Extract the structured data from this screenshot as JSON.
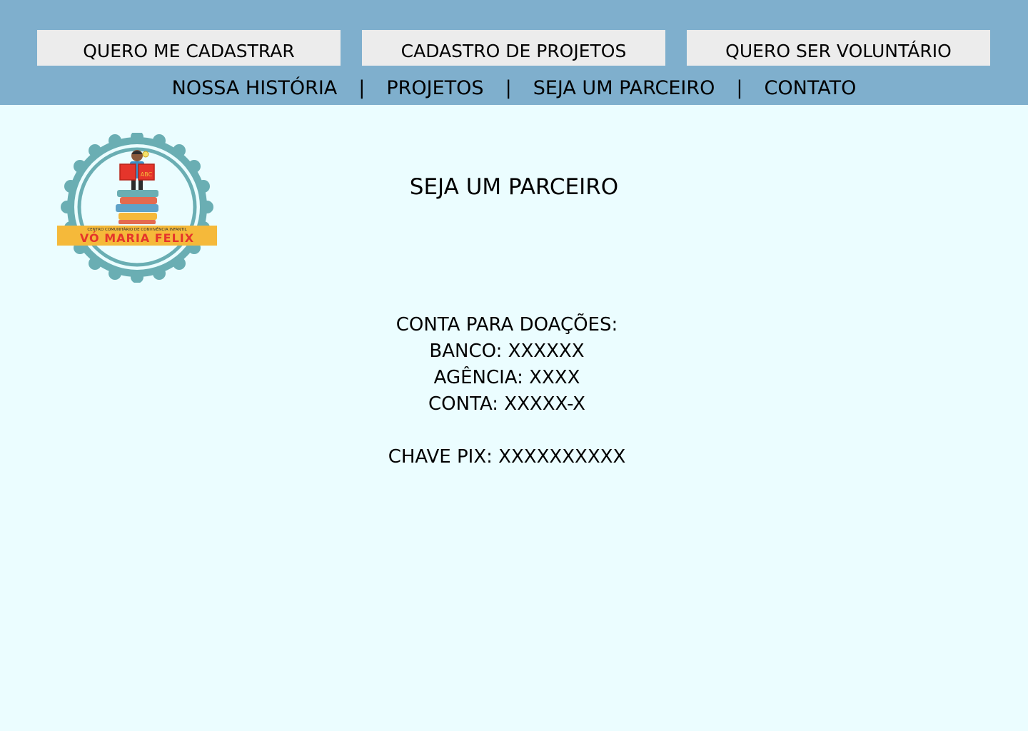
{
  "header": {
    "buttons": [
      {
        "label": "QUERO ME CADASTRAR"
      },
      {
        "label": "CADASTRO DE PROJETOS"
      },
      {
        "label": "QUERO SER VOLUNTÁRIO"
      }
    ],
    "nav": {
      "items": [
        "NOSSA HISTÓRIA",
        "PROJETOS",
        "SEJA UM PARCEIRO",
        "CONTATO"
      ],
      "separator": "|"
    }
  },
  "logo": {
    "subtitle": "CENTRO COMUNITÁRIO DE CONVIVÊNCIA INFANTIL",
    "name": "VÓ MARIA FELIX",
    "book_text": "ABC"
  },
  "main": {
    "title": "SEJA UM PARCEIRO",
    "donation": {
      "heading": "CONTA PARA DOAÇÕES:",
      "bank": "BANCO: XXXXXX",
      "agency": "AGÊNCIA: XXXX",
      "account": "CONTA: XXXXX-X",
      "pix": "CHAVE PIX: XXXXXXXXXX"
    }
  },
  "colors": {
    "header_bg": "#7fafcd",
    "page_bg": "#ebfdff",
    "button_bg": "#ececec",
    "logo_ring": "#6aaeb3",
    "logo_banner": "#f5b93a",
    "logo_name": "#e5352b"
  }
}
